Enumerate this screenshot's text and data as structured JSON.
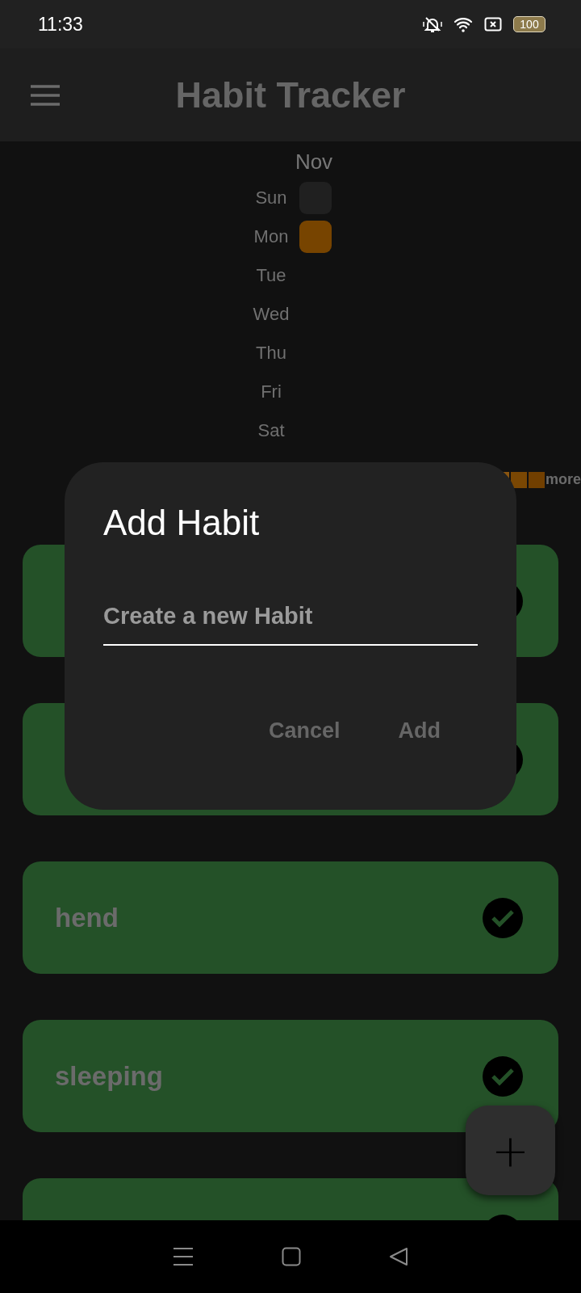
{
  "status_bar": {
    "time": "11:33",
    "battery": "100"
  },
  "app_bar": {
    "title": "Habit Tracker"
  },
  "heatmap": {
    "month": "Nov",
    "days": [
      "Sun",
      "Mon",
      "Tue",
      "Wed",
      "Thu",
      "Fri",
      "Sat"
    ],
    "cells": [
      {
        "done": false
      },
      {
        "done": true
      }
    ],
    "legend": {
      "swatches": [
        {
          "color": "#8a5510"
        },
        {
          "color": "#7a4703"
        },
        {
          "color": "#713f00"
        }
      ],
      "label": "more"
    }
  },
  "habits": [
    {
      "completed": true
    },
    {
      "completed": true
    },
    {
      "name": "hend",
      "completed": true
    },
    {
      "name": "sleeping",
      "completed": true
    },
    {
      "completed": true
    }
  ],
  "dialog": {
    "title": "Add Habit",
    "field": {
      "placeholder": "Create a new Habit"
    },
    "buttons": [
      "Cancel",
      "Add"
    ]
  },
  "fab": {
    "label": "+"
  }
}
